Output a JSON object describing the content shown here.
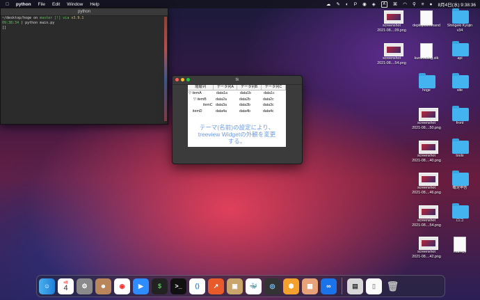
{
  "menubar": {
    "app_name": "python",
    "menus": [
      "File",
      "Edit",
      "Window",
      "Help"
    ],
    "datetime": "8月4日(水) 9:38:36"
  },
  "terminal": {
    "title": "python",
    "line1_path": "~/desktop/hoge on ",
    "line1_branch": "master [!] via ",
    "line1_version": "v3.9.1",
    "line2_time": "09:38:34",
    "line2_cmd": " ) python main.py",
    "line3": "[]"
  },
  "tk_window": {
    "title": "tk",
    "columns": [
      "階層列",
      "データ列A",
      "データ列B",
      "データ列C"
    ],
    "rows": [
      {
        "name": "▽ itemA",
        "a": "data1a",
        "b": "data1b",
        "c": "data1c",
        "indent": 0
      },
      {
        "name": "▽ itemB",
        "a": "data2a",
        "b": "data2b",
        "c": "data2c",
        "indent": 1
      },
      {
        "name": "itemC",
        "a": "data3a",
        "b": "data3b",
        "c": "data3c",
        "indent": 2
      },
      {
        "name": "itemD",
        "a": "data4a",
        "b": "data4b",
        "c": "data4c",
        "indent": 0
      }
    ],
    "message_line1": "テーマ(名前)の設定により、",
    "message_line2": "treeview Widgetの外観を変更",
    "message_line3": "する。"
  },
  "desktop_icons": [
    {
      "label1": "screenshot",
      "label2": "2021-08....09.png",
      "kind": "shot"
    },
    {
      "label1": "deploy.command",
      "label2": "",
      "kind": "doc"
    },
    {
      "label1": "Shingeki Kyojin",
      "label2": "v34",
      "kind": "folder"
    },
    {
      "label1": "screenshot",
      "label2": "2021-08....54.png",
      "kind": "shot"
    },
    {
      "label1": "kuroro.blog.stk",
      "label2": "",
      "kind": "doc"
    },
    {
      "label1": "api",
      "label2": "",
      "kind": "folder"
    },
    {
      "label1": "hoge",
      "label2": "",
      "kind": "folder"
    },
    {
      "label1": "site",
      "label2": "",
      "kind": "folder"
    },
    {
      "label1": "screenshot",
      "label2": "2021-08....50.png",
      "kind": "shot"
    },
    {
      "label1": "front",
      "label2": "",
      "kind": "folder"
    },
    {
      "label1": "screenshot",
      "label2": "2021-08....40.png",
      "kind": "shot"
    },
    {
      "label1": "tools",
      "label2": "",
      "kind": "folder"
    },
    {
      "label1": "screenshot",
      "label2": "2021-08....46.png",
      "kind": "shot"
    },
    {
      "label1": "確定申告",
      "label2": "",
      "kind": "folder"
    },
    {
      "label1": "screenshot",
      "label2": "2021-08....54.png",
      "kind": "shot"
    },
    {
      "label1": "ロゴ",
      "label2": "",
      "kind": "folder"
    },
    {
      "label1": "screenshot",
      "label2": "2021-08....42.png",
      "kind": "shot"
    },
    {
      "label1": "main.py",
      "label2": "",
      "kind": "doc"
    }
  ],
  "dock": {
    "calendar_day": "4",
    "calendar_month": "8月",
    "apps": [
      "finder",
      "calendar",
      "system-preferences",
      "contacts",
      "chrome",
      "zoom",
      "terminal-1",
      "terminal-2",
      "vscode",
      "git-client",
      "package",
      "docker",
      "quicktime",
      "sourcetree",
      "photo",
      "infinity"
    ],
    "others": [
      "preview",
      "document",
      "trash"
    ]
  }
}
